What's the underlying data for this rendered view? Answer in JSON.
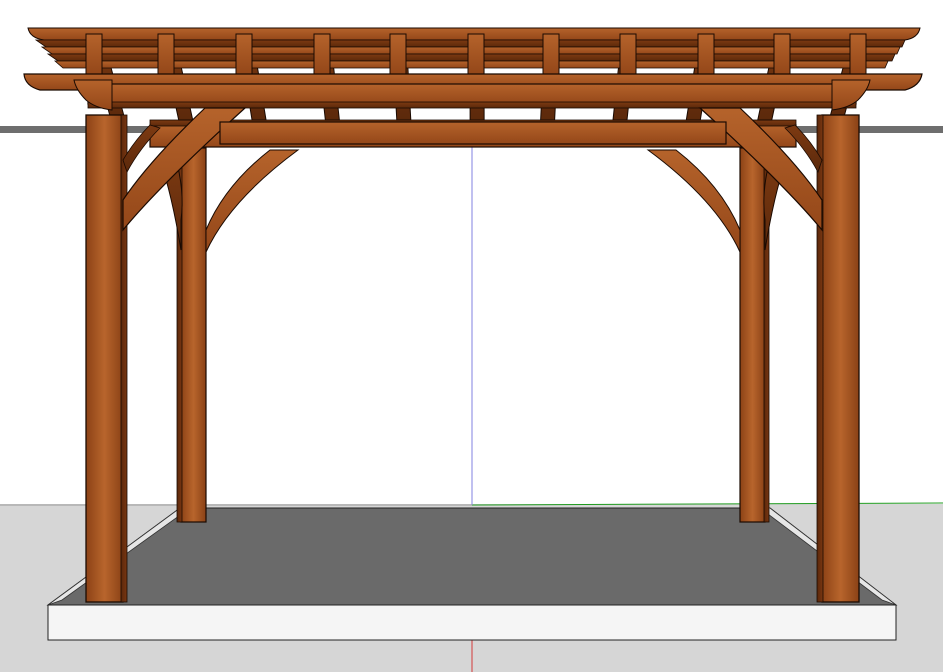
{
  "colors": {
    "sky": "#ffffff",
    "ground": "#d6d6d6",
    "horizon": "#6e6e6e",
    "axis_green": "#1e9a1e",
    "axis_blue": "#8080e0",
    "axis_red": "#d43a3a",
    "wood": "#9a4c1e",
    "wood_light": "#b3612a",
    "wood_dark": "#5e2a0c",
    "edge": "#1a0a02",
    "slab_top": "#6a6a6a",
    "slab_face": "#f5f5f5"
  },
  "icons": {
    "main_subject": "pergola-model-icon"
  }
}
